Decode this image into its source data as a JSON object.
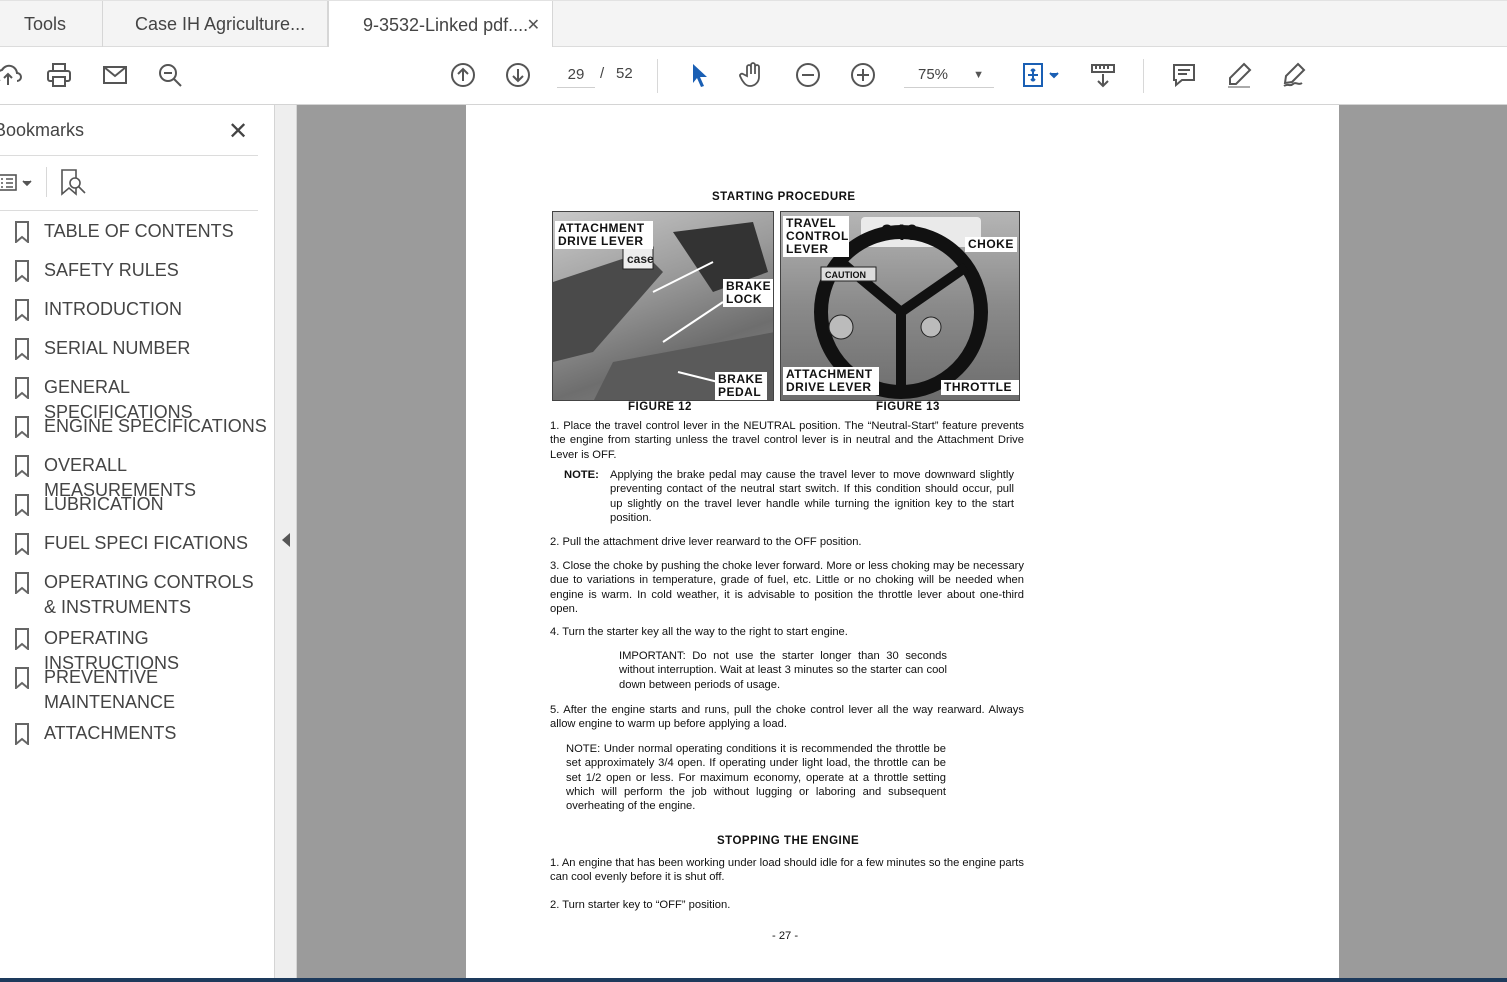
{
  "tabs": {
    "tools": "Tools",
    "doc1": "Case IH Agriculture...",
    "doc2": "9-3532-Linked pdf...."
  },
  "toolbar": {
    "page_current": "29",
    "page_sep": "/",
    "page_total": "52",
    "zoom": "75%"
  },
  "bookmarks": {
    "title": "Bookmarks",
    "items": [
      {
        "label": "TABLE OF CONTENTS"
      },
      {
        "label": "SAFETY RULES"
      },
      {
        "label": "INTRODUCTION"
      },
      {
        "label": "SERIAL NUMBER"
      },
      {
        "label": "GENERAL SPECIFICATIONS"
      },
      {
        "label": "ENGINE SPECIFICATIONS"
      },
      {
        "label": "OVERALL MEASUREMENTS"
      },
      {
        "label": "LUBRICATION"
      },
      {
        "label": "FUEL SPECI FICATIONS"
      },
      {
        "label": "OPERATING CONTROLS & INSTRUMENTS"
      },
      {
        "label": "OPERATING INSTRUCTIONS"
      },
      {
        "label": "PREVENTIVE MAINTENANCE"
      },
      {
        "label": "ATTACHMENTS"
      }
    ]
  },
  "document": {
    "heading": "STARTING PROCEDURE",
    "fig12": {
      "caption": "FIGURE 12",
      "callout_attach": "ATTACHMENT DRIVE LEVER",
      "callout_brake_lock": "BRAKE LOCK",
      "callout_brake_pedal": "BRAKE PEDAL",
      "logo": "case"
    },
    "fig13": {
      "caption": "FIGURE 13",
      "callout_travel": "TRAVEL CONTROL LEVER",
      "callout_choke": "CHOKE",
      "callout_attach": "ATTACHMENT DRIVE LEVER",
      "callout_throttle": "THROTTLE",
      "badge": "946",
      "caution": "CAUTION"
    },
    "step1": "1.  Place the travel control lever in the NEUTRAL position. The “Neutral-Start” feature prevents the engine from starting unless the travel control lever is in neutral and the Attachment Drive Lever is OFF.",
    "note1_label": "NOTE:",
    "note1": "Applying the brake pedal may cause the travel lever to move downward slightly preventing contact of the neutral start switch. If this condition should occur, pull up slightly on the travel lever handle while turning the ignition key to the start position.",
    "step2": "2.  Pull the attachment drive lever rearward to the OFF position.",
    "step3": "3.  Close the choke by pushing the choke lever forward. More or less choking may be necessary due to variations in temperature, grade of fuel, etc. Little or no choking will be needed when engine is warm. In cold weather, it is advisable to position the throttle lever about one-third open.",
    "step4": "4.  Turn the starter key all the way to the right to start engine.",
    "important": "IMPORTANT: Do not use the starter longer than 30 seconds without interruption. Wait at least 3 minutes so the starter can cool down between periods of usage.",
    "step5": "5.  After the engine starts and runs, pull the choke control lever all the way rearward. Always allow engine to warm up before applying a load.",
    "note2": "NOTE: Under normal operating conditions it is recommended the throttle be set approximately 3/4 open. If operating under light load, the throttle can be set 1/2 open or less. For maximum economy, operate at a throttle setting which will perform the job without lugging or laboring and subsequent overheating of the engine.",
    "heading2": "STOPPING THE ENGINE",
    "stop1": "1.  An engine that has been working under load should idle for a few minutes so the engine parts can cool evenly before it is shut off.",
    "stop2": "2.  Turn starter key to “OFF” position.",
    "page_label": "- 27 -"
  }
}
